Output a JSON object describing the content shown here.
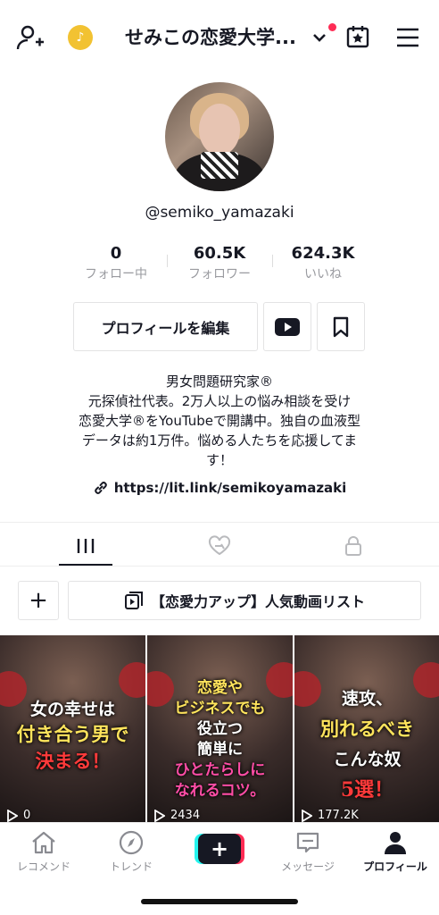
{
  "header": {
    "title": "せみこの恋愛大学...",
    "coin_icon": "tiktok-coin-icon"
  },
  "profile": {
    "username": "@semiko_yamazaki",
    "stats": [
      {
        "value": "0",
        "label": "フォロー中"
      },
      {
        "value": "60.5K",
        "label": "フォロワー"
      },
      {
        "value": "624.3K",
        "label": "いいね"
      }
    ],
    "edit_label": "プロフィールを編集",
    "bio": [
      "男女問題研究家®",
      "元探偵社代表。2万人以上の悩み相談を受け",
      "恋愛大学®をYouTubeで開講中。独自の血液型",
      "データは約1万件。悩める人たちを応援してま",
      "す！"
    ],
    "link": "https://lit.link/semikoyamazaki"
  },
  "playlist": {
    "plus": "+",
    "label": "【恋愛力アップ】人気動画リスト"
  },
  "videos": [
    {
      "lines": [
        "女の幸せは",
        "付き合う男で",
        "決まる！"
      ],
      "views": "0"
    },
    {
      "lines": [
        "恋愛や",
        "ビジネスでも",
        "役立つ",
        "簡単に",
        "ひとたらしに",
        "なれるコツ。"
      ],
      "views": "2434"
    },
    {
      "lines": [
        "速攻、",
        "別れるべき",
        "こんな奴",
        "5選！"
      ],
      "views": "177.2K"
    }
  ],
  "nav": [
    {
      "label": "レコメンド"
    },
    {
      "label": "トレンド"
    },
    {
      "label": "+"
    },
    {
      "label": "メッセージ"
    },
    {
      "label": "プロフィール"
    }
  ],
  "colors": {
    "accent": "#fe2c55",
    "cyan": "#25f4ee",
    "text": "#161823",
    "muted": "#9a9ba0",
    "headline_yellow": "#ffe45c",
    "headline_red": "#ff3a3a"
  }
}
